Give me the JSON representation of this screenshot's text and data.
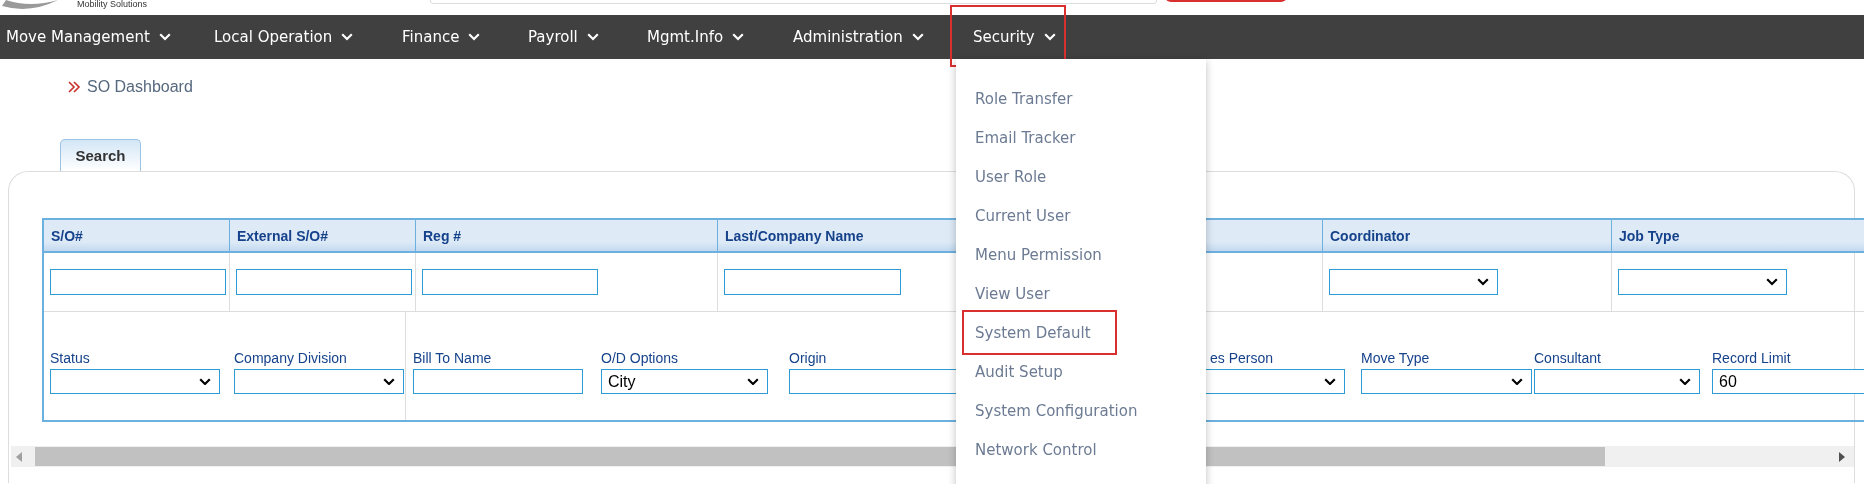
{
  "header": {
    "logo_tagline": "Mobility Solutions"
  },
  "nav": {
    "items": [
      {
        "label": "Move Management",
        "selected": false
      },
      {
        "label": "Local Operation",
        "selected": false
      },
      {
        "label": "Finance",
        "selected": false
      },
      {
        "label": "Payroll",
        "selected": false
      },
      {
        "label": "Mgmt.Info",
        "selected": false
      },
      {
        "label": "Administration",
        "selected": false
      },
      {
        "label": "Security",
        "selected": true
      }
    ]
  },
  "security_menu": {
    "items": [
      {
        "label": "Role Transfer",
        "selected": false
      },
      {
        "label": "Email Tracker",
        "selected": false
      },
      {
        "label": "User Role",
        "selected": false
      },
      {
        "label": "Current User",
        "selected": false
      },
      {
        "label": "Menu Permission",
        "selected": false
      },
      {
        "label": "View User",
        "selected": false
      },
      {
        "label": "System Default",
        "selected": true
      },
      {
        "label": "Audit Setup",
        "selected": false
      },
      {
        "label": "System Configuration",
        "selected": false
      },
      {
        "label": "Network Control",
        "selected": false
      }
    ]
  },
  "breadcrumb": "SO Dashboard",
  "tabs": [
    {
      "label": "Search",
      "selected": true
    }
  ],
  "search_table": {
    "columns": [
      "S/O#",
      "External S/O#",
      "Reg #",
      "Last/Company Name",
      "Coordinator",
      "Job Type"
    ],
    "filters": [
      {
        "kind": "text"
      },
      {
        "kind": "text"
      },
      {
        "kind": "text"
      },
      {
        "kind": "text"
      },
      {
        "kind": "select"
      },
      {
        "kind": "select"
      }
    ],
    "fields": [
      {
        "label": "Status",
        "kind": "select"
      },
      {
        "label": "Company Division",
        "kind": "select"
      },
      {
        "label": "Bill To Name",
        "kind": "text"
      },
      {
        "label": "O/D Options",
        "kind": "select",
        "value": "City"
      },
      {
        "label": "Origin",
        "kind": "text"
      },
      {
        "label": "es Person",
        "kind": "select"
      },
      {
        "label": "Move Type",
        "kind": "select"
      },
      {
        "label": "Consultant",
        "kind": "select"
      },
      {
        "label": "Record Limit",
        "kind": "text",
        "value": "60"
      }
    ]
  }
}
